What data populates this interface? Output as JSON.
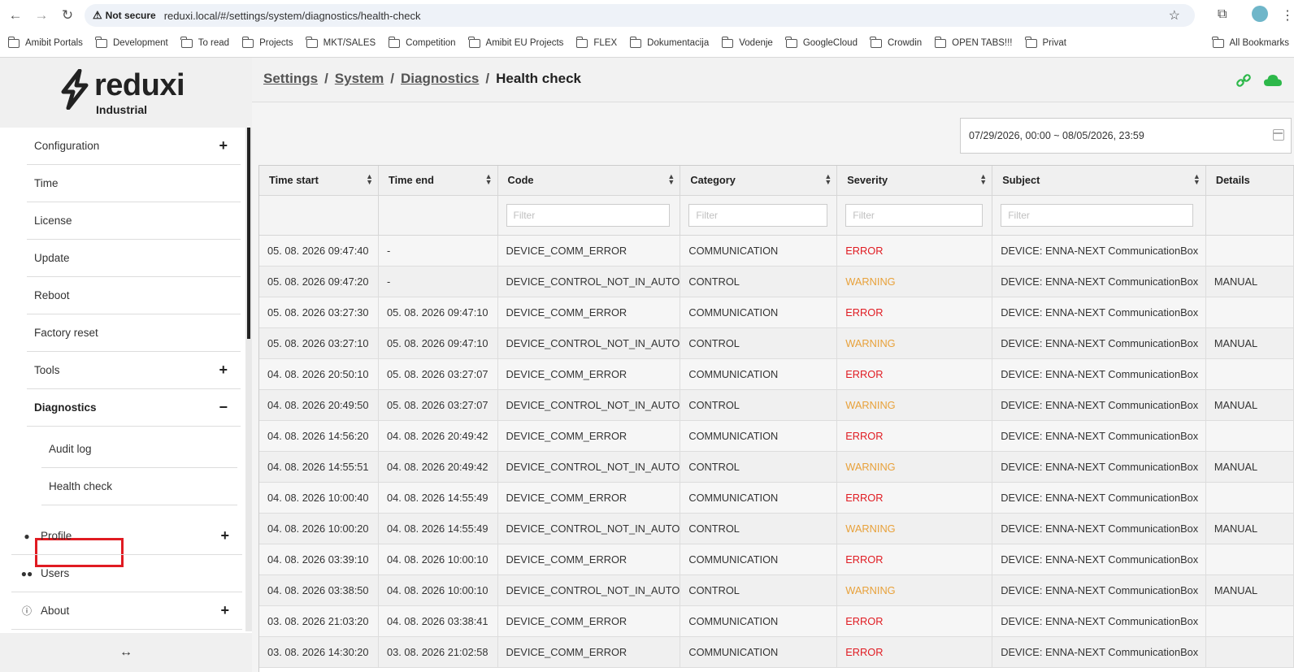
{
  "browser": {
    "security_label": "Not secure",
    "url": "reduxi.local/#/settings/system/diagnostics/health-check",
    "bookmarks": [
      "Amibit Portals",
      "Development",
      "To read",
      "Projects",
      "MKT/SALES",
      "Competition",
      "Amibit EU Projects",
      "FLEX",
      "Dokumentacija",
      "Vodenje",
      "GoogleCloud",
      "Crowdin",
      "OPEN TABS!!!",
      "Privat"
    ],
    "all_bookmarks": "All Bookmarks"
  },
  "app": {
    "brand": "reduxi",
    "brand_sub": "Industrial"
  },
  "sidebar": {
    "items": [
      {
        "label": "Configuration",
        "expand": "+"
      },
      {
        "label": "Time"
      },
      {
        "label": "License"
      },
      {
        "label": "Update"
      },
      {
        "label": "Reboot"
      },
      {
        "label": "Factory reset"
      },
      {
        "label": "Tools",
        "expand": "+"
      },
      {
        "label": "Diagnostics",
        "expand": "−"
      }
    ],
    "sub_items": [
      "Audit log",
      "Health check"
    ],
    "top_items": [
      {
        "label": "Profile",
        "icon": "user-icon",
        "expand": "+"
      },
      {
        "label": "Users",
        "icon": "users-icon"
      },
      {
        "label": "About",
        "icon": "info-icon",
        "expand": "+"
      }
    ],
    "footer_icon": "↔"
  },
  "breadcrumb": {
    "items": [
      "Settings",
      "System",
      "Diagnostics"
    ],
    "current": "Health check",
    "separator": "/"
  },
  "date_range": "07/29/2026, 00:00 ~ 08/05/2026, 23:59",
  "table": {
    "columns": [
      "Time start",
      "Time end",
      "Code",
      "Category",
      "Severity",
      "Subject",
      "Details"
    ],
    "filter_placeholder": "Filter",
    "rows": [
      [
        "05. 08. 2026 09:47:40",
        "-",
        "DEVICE_COMM_ERROR",
        "COMMUNICATION",
        "ERROR",
        "DEVICE: ENNA-NEXT CommunicationBox",
        ""
      ],
      [
        "05. 08. 2026 09:47:20",
        "-",
        "DEVICE_CONTROL_NOT_IN_AUTO",
        "CONTROL",
        "WARNING",
        "DEVICE: ENNA-NEXT CommunicationBox",
        "MANUAL"
      ],
      [
        "05. 08. 2026 03:27:30",
        "05. 08. 2026 09:47:10",
        "DEVICE_COMM_ERROR",
        "COMMUNICATION",
        "ERROR",
        "DEVICE: ENNA-NEXT CommunicationBox",
        ""
      ],
      [
        "05. 08. 2026 03:27:10",
        "05. 08. 2026 09:47:10",
        "DEVICE_CONTROL_NOT_IN_AUTO",
        "CONTROL",
        "WARNING",
        "DEVICE: ENNA-NEXT CommunicationBox",
        "MANUAL"
      ],
      [
        "04. 08. 2026 20:50:10",
        "05. 08. 2026 03:27:07",
        "DEVICE_COMM_ERROR",
        "COMMUNICATION",
        "ERROR",
        "DEVICE: ENNA-NEXT CommunicationBox",
        ""
      ],
      [
        "04. 08. 2026 20:49:50",
        "05. 08. 2026 03:27:07",
        "DEVICE_CONTROL_NOT_IN_AUTO",
        "CONTROL",
        "WARNING",
        "DEVICE: ENNA-NEXT CommunicationBox",
        "MANUAL"
      ],
      [
        "04. 08. 2026 14:56:20",
        "04. 08. 2026 20:49:42",
        "DEVICE_COMM_ERROR",
        "COMMUNICATION",
        "ERROR",
        "DEVICE: ENNA-NEXT CommunicationBox",
        ""
      ],
      [
        "04. 08. 2026 14:55:51",
        "04. 08. 2026 20:49:42",
        "DEVICE_CONTROL_NOT_IN_AUTO",
        "CONTROL",
        "WARNING",
        "DEVICE: ENNA-NEXT CommunicationBox",
        "MANUAL"
      ],
      [
        "04. 08. 2026 10:00:40",
        "04. 08. 2026 14:55:49",
        "DEVICE_COMM_ERROR",
        "COMMUNICATION",
        "ERROR",
        "DEVICE: ENNA-NEXT CommunicationBox",
        ""
      ],
      [
        "04. 08. 2026 10:00:20",
        "04. 08. 2026 14:55:49",
        "DEVICE_CONTROL_NOT_IN_AUTO",
        "CONTROL",
        "WARNING",
        "DEVICE: ENNA-NEXT CommunicationBox",
        "MANUAL"
      ],
      [
        "04. 08. 2026 03:39:10",
        "04. 08. 2026 10:00:10",
        "DEVICE_COMM_ERROR",
        "COMMUNICATION",
        "ERROR",
        "DEVICE: ENNA-NEXT CommunicationBox",
        ""
      ],
      [
        "04. 08. 2026 03:38:50",
        "04. 08. 2026 10:00:10",
        "DEVICE_CONTROL_NOT_IN_AUTO",
        "CONTROL",
        "WARNING",
        "DEVICE: ENNA-NEXT CommunicationBox",
        "MANUAL"
      ],
      [
        "03. 08. 2026 21:03:20",
        "04. 08. 2026 03:38:41",
        "DEVICE_COMM_ERROR",
        "COMMUNICATION",
        "ERROR",
        "DEVICE: ENNA-NEXT CommunicationBox",
        ""
      ],
      [
        "03. 08. 2026 14:30:20",
        "03. 08. 2026 21:02:58",
        "DEVICE_COMM_ERROR",
        "COMMUNICATION",
        "ERROR",
        "DEVICE: ENNA-NEXT CommunicationBox",
        ""
      ]
    ]
  },
  "colors": {
    "error": "#e01b22",
    "warning": "#e8a13a",
    "cloud": "#2db84a",
    "highlight_box": "#e01b22"
  }
}
